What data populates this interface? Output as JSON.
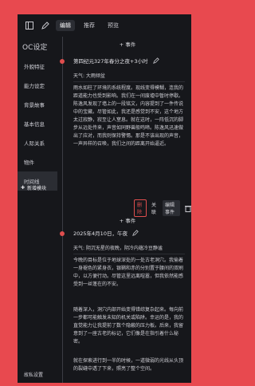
{
  "toolbar": {
    "tabs": [
      "编辑",
      "推荐",
      "预览"
    ]
  },
  "sidebar": {
    "title": "OC设定",
    "items": [
      "外貌特征",
      "能力设定",
      "背景故事",
      "基本信息",
      "人际关系",
      "物件",
      "时间线"
    ],
    "add_module": "新增模块",
    "footer": "故私设置"
  },
  "timeline": {
    "add_event_label": "+ 事件",
    "events": [
      {
        "date": "第四纪元327年春分之夜+3小时",
        "weather": "天气: 大雨倾盆",
        "content": "雨水如柱了环境的系统程度。现线变得模糊，连我的距道能力也受到影响。我们在一间废墟中暂时停歇。陈逸风发现了墙上的一段铭文，内容提到了一件传说中的宝藏。尽管如此，我还是感觉到不安，这个地方太过寂静，寂至让人窒息。就在这时，一阵低沉的脚步从远处传来，声音如同野兽般鸣啼。陈逸风迅速做出了应对，而我则保持警惕。那是不该出现的声音，一声异样的召唤，我们之间的距离开始逼近。",
        "actions": {
          "delete": "删除",
          "link": "关联",
          "edit": "编辑事件"
        }
      },
      {
        "date": "2025年4月10日，午夜",
        "weather": "天气: 阴沉无星的夜晚，阴冷内蕴冷豆静谧",
        "para1": "今晚的目标是位于地球深处的一处古老洞穴。我偷着一身褪色的紧身衣，银鞘和赤的分别置于腰间的双刷中，以方便行动。尽管这里远离喧嚣，但我依然能感受到一丝蓬在的不安。",
        "para2": "随着深入，洞穴内部开始变得错综复杂起来。每向前一步都可能触发未知的机关或陷阱。幸运的是，我的直觉能力让我提前了数个隐蔽的压力板。后来，我留意到了一座古老的标记，它们像是在指引着什么秘密。",
        "para3": "就在探索进行到一半的时候，一道微弱的光线从头顶的裂缝中透了下来，照亮了整个空间。"
      }
    ]
  }
}
